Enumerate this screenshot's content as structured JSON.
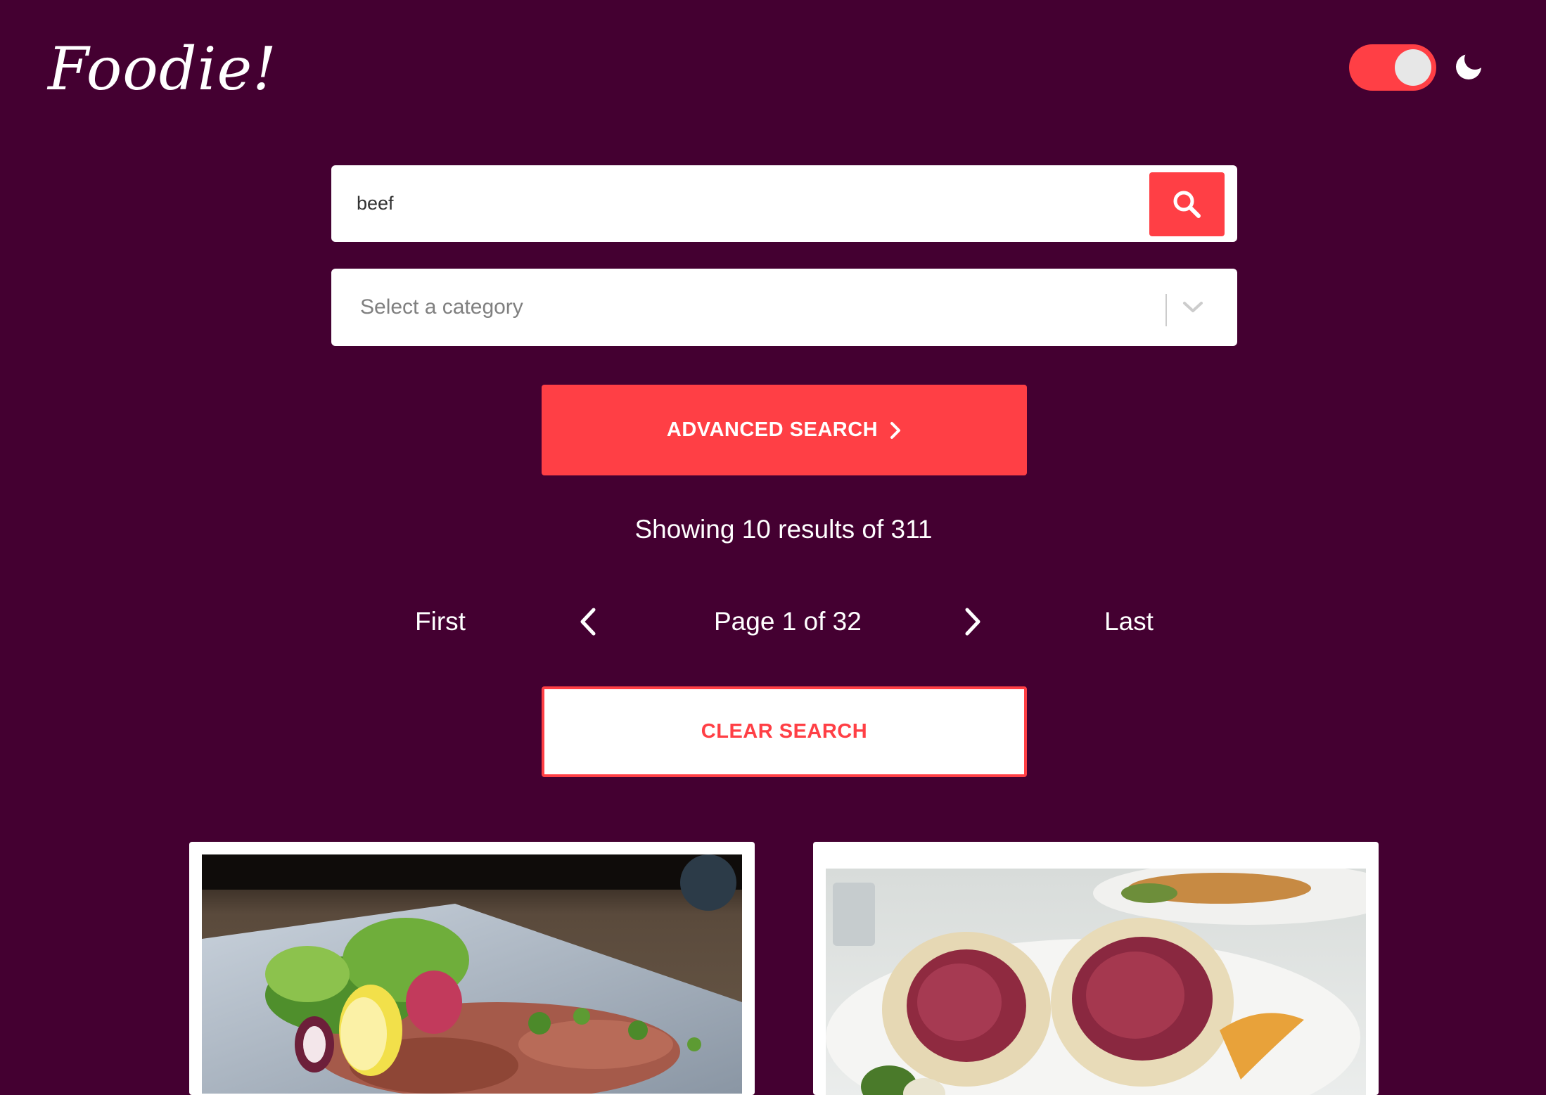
{
  "app": {
    "logo_text": "Foodie!"
  },
  "header": {
    "theme_toggle_on": true,
    "theme_icon": "moon-icon"
  },
  "search": {
    "value": "beef",
    "placeholder": "",
    "button_icon": "search-icon"
  },
  "category": {
    "placeholder": "Select a category",
    "dropdown_icon": "chevron-down-icon"
  },
  "advanced_search": {
    "label": "ADVANCED SEARCH",
    "icon": "chevron-right-icon"
  },
  "results": {
    "summary": "Showing 10 results of 311"
  },
  "pagination": {
    "first_label": "First",
    "prev_icon": "chevron-left-icon",
    "page_label": "Page 1 of 32",
    "next_icon": "chevron-right-icon",
    "last_label": "Last"
  },
  "clear_search": {
    "label": "CLEAR SEARCH"
  },
  "colors": {
    "background": "#440031",
    "accent": "#ff3f45",
    "surface": "#ffffff"
  },
  "results_cards": [
    {
      "image": "beef carpaccio with salad and lemon"
    },
    {
      "image": "beef wellington slices"
    }
  ]
}
